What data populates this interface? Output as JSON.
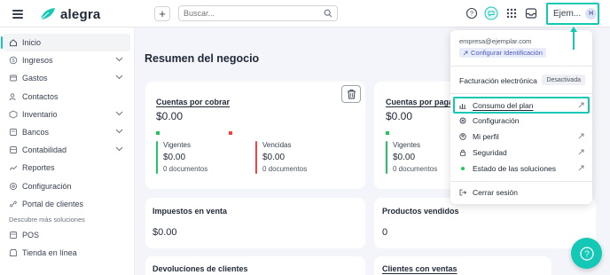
{
  "header": {
    "logo_text": "alegra",
    "search_placeholder": "Buscar...",
    "user_name": "Ejem...",
    "avatar_initial": "H"
  },
  "sidebar": {
    "items": [
      {
        "label": "Inicio",
        "icon": "home-icon",
        "active": true
      },
      {
        "label": "Ingresos",
        "icon": "income-icon",
        "expandable": true
      },
      {
        "label": "Gastos",
        "icon": "expenses-icon",
        "expandable": true
      },
      {
        "label": "Contactos",
        "icon": "contacts-icon"
      },
      {
        "label": "Inventario",
        "icon": "inventory-icon",
        "expandable": true
      },
      {
        "label": "Bancos",
        "icon": "bank-icon",
        "expandable": true
      },
      {
        "label": "Contabilidad",
        "icon": "accounting-icon",
        "expandable": true
      },
      {
        "label": "Reportes",
        "icon": "reports-icon"
      },
      {
        "label": "Configuración",
        "icon": "settings-icon"
      },
      {
        "label": "Portal de clientes",
        "icon": "link-icon"
      }
    ],
    "section_label": "Descubre más soluciones",
    "solutions": [
      {
        "label": "POS",
        "icon": "pos-icon"
      },
      {
        "label": "Tienda en línea",
        "icon": "store-icon"
      }
    ]
  },
  "main": {
    "page_title": "Resumen del negocio",
    "cxc": {
      "title": "Cuentas por cobrar",
      "value": "$0.00",
      "vigentes_label": "Vigentes",
      "vigentes_value": "$0.00",
      "vigentes_docs": "0 documentos",
      "vencidas_label": "Vencidas",
      "vencidas_value": "$0.00",
      "vencidas_docs": "0 documentos"
    },
    "cxp": {
      "title": "Cuentas por pagar",
      "value": "$0.00",
      "vigentes_label": "Vigentes",
      "vigentes_value": "$0.00",
      "vigentes_docs": "0 documentos"
    },
    "impuestos": {
      "title": "Impuestos en venta",
      "value": "$0.00"
    },
    "productos": {
      "title": "Productos vendidos",
      "value": "0"
    },
    "devoluciones": {
      "title": "Devoluciones de clientes"
    },
    "clientes": {
      "title": "Clientes con ventas"
    }
  },
  "dropdown": {
    "email": "empresa@ejemplar.com",
    "config_id": "Configurar Identificación",
    "factura_label": "Facturación electrónica",
    "factura_status": "Desactivada",
    "items": [
      {
        "label": "Consumo del plan",
        "icon": "chart-bar-icon"
      },
      {
        "label": "Configuración",
        "icon": "gear-icon"
      },
      {
        "label": "Mi perfil",
        "icon": "profile-icon"
      },
      {
        "label": "Seguridad",
        "icon": "lock-icon"
      },
      {
        "label": "Estado de las soluciones",
        "icon": "status-dot-icon"
      }
    ],
    "logout": "Cerrar sesión"
  },
  "colors": {
    "accent": "#13c8b4",
    "green": "#22c55e",
    "red": "#ef4444",
    "badge_blue": "#4a5bc4"
  }
}
